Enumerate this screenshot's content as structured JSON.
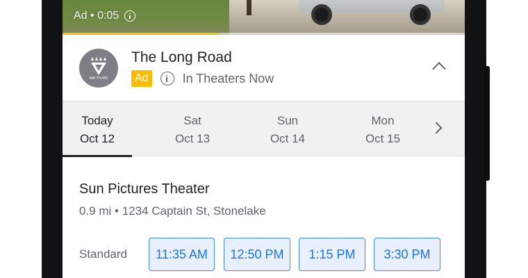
{
  "video": {
    "ad_timer": "Ad • 0:05",
    "progress": 0.39
  },
  "movie": {
    "logo_text": "RW FILMS",
    "title": "The Long Road",
    "ad_badge": "Ad",
    "status": "In Theaters Now"
  },
  "date_tabs": [
    {
      "day": "Today",
      "date": "Oct 12",
      "selected": true
    },
    {
      "day": "Sat",
      "date": "Oct 13",
      "selected": false
    },
    {
      "day": "Sun",
      "date": "Oct 14",
      "selected": false
    },
    {
      "day": "Mon",
      "date": "Oct 15",
      "selected": false
    }
  ],
  "theater": {
    "name": "Sun Pictures Theater",
    "address": "0.9 mi • 1234 Captain St, Stonelake",
    "format": "Standard",
    "showtimes": [
      "11:35 AM",
      "12:50 PM",
      "1:15 PM",
      "3:30 PM"
    ]
  },
  "colors": {
    "accent_blue": "#1a73e8",
    "ad_yellow": "#fbbc04",
    "tab_background": "#f1f1f2"
  },
  "icons": {
    "video_info": "info-icon",
    "meta_info": "info-icon",
    "collapse": "chevron-up-icon",
    "next_dates": "chevron-right-icon"
  }
}
